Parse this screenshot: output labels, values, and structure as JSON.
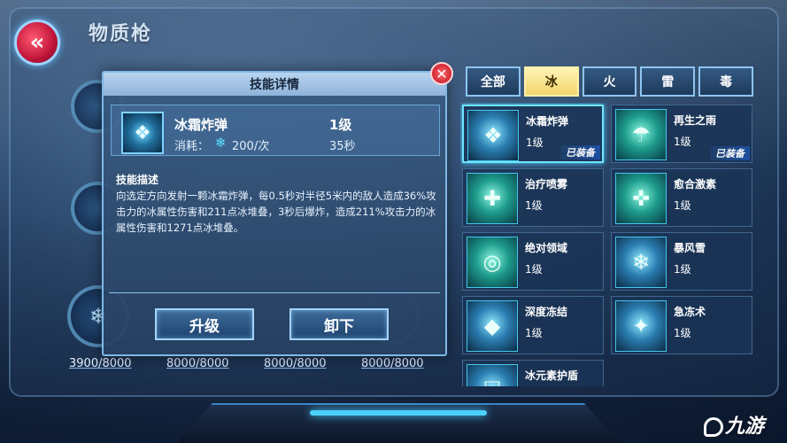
{
  "page": {
    "title": "物质枪"
  },
  "energy_bars": [
    "3900/8000",
    "8000/8000",
    "8000/8000",
    "8000/8000"
  ],
  "modal": {
    "header": "技能详情",
    "close_label": "✕",
    "skill": {
      "name": "冰霜炸弹",
      "level": "1级",
      "cost_label": "消耗：",
      "cost_value": "200/次",
      "cooldown": "35秒"
    },
    "description_title": "技能描述",
    "description": "向选定方向发射一颗冰霜炸弹，每0.5秒对半径5米内的敌人造成36%攻击力的冰属性伤害和211点冰堆叠，3秒后爆炸，造成211%攻击力的冰属性伤害和1271点冰堆叠。",
    "upgrade_label": "升级",
    "unload_label": "卸下"
  },
  "tabs": [
    {
      "label": "全部",
      "active": false
    },
    {
      "label": "冰",
      "active": true
    },
    {
      "label": "火",
      "active": false
    },
    {
      "label": "雷",
      "active": false
    },
    {
      "label": "毒",
      "active": false
    }
  ],
  "skills": [
    {
      "name": "冰霜炸弹",
      "level": "1级",
      "badge": "已装备",
      "icon": "snowflake-bomb-icon"
    },
    {
      "name": "再生之雨",
      "level": "1级",
      "badge": "已装备",
      "icon": "rain-heal-icon"
    },
    {
      "name": "治疗喷雾",
      "level": "1级",
      "badge": "",
      "icon": "spray-icon"
    },
    {
      "name": "愈合激素",
      "level": "1级",
      "badge": "",
      "icon": "hormone-icon"
    },
    {
      "name": "绝对领域",
      "level": "1级",
      "badge": "",
      "icon": "field-icon"
    },
    {
      "name": "暴风雪",
      "level": "1级",
      "badge": "",
      "icon": "blizzard-icon"
    },
    {
      "name": "深度冻结",
      "level": "1级",
      "badge": "",
      "icon": "deep-freeze-icon"
    },
    {
      "name": "急冻术",
      "level": "1级",
      "badge": "",
      "icon": "quick-freeze-icon"
    },
    {
      "name": "冰元素护盾",
      "level": "",
      "badge": "",
      "icon": "ice-shield-icon"
    }
  ],
  "watermark": "九游"
}
